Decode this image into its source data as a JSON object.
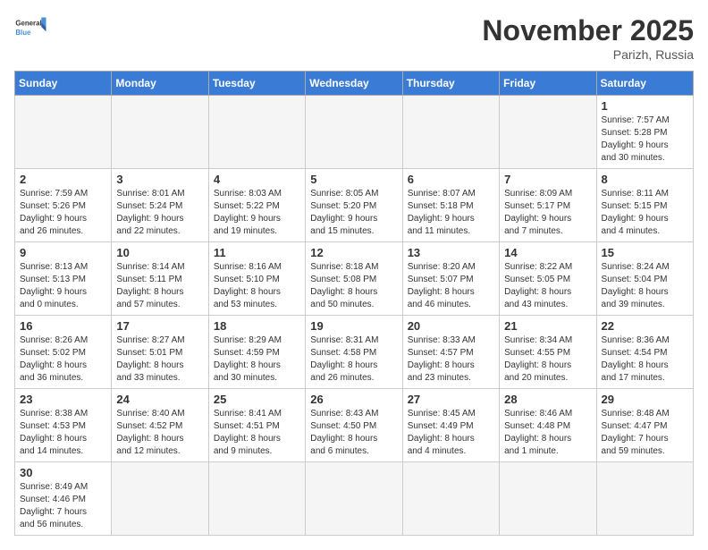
{
  "header": {
    "logo_general": "General",
    "logo_blue": "Blue",
    "month": "November 2025",
    "location": "Parizh, Russia"
  },
  "weekdays": [
    "Sunday",
    "Monday",
    "Tuesday",
    "Wednesday",
    "Thursday",
    "Friday",
    "Saturday"
  ],
  "weeks": [
    [
      {
        "day": "",
        "info": ""
      },
      {
        "day": "",
        "info": ""
      },
      {
        "day": "",
        "info": ""
      },
      {
        "day": "",
        "info": ""
      },
      {
        "day": "",
        "info": ""
      },
      {
        "day": "",
        "info": ""
      },
      {
        "day": "1",
        "info": "Sunrise: 7:57 AM\nSunset: 5:28 PM\nDaylight: 9 hours\nand 30 minutes."
      }
    ],
    [
      {
        "day": "2",
        "info": "Sunrise: 7:59 AM\nSunset: 5:26 PM\nDaylight: 9 hours\nand 26 minutes."
      },
      {
        "day": "3",
        "info": "Sunrise: 8:01 AM\nSunset: 5:24 PM\nDaylight: 9 hours\nand 22 minutes."
      },
      {
        "day": "4",
        "info": "Sunrise: 8:03 AM\nSunset: 5:22 PM\nDaylight: 9 hours\nand 19 minutes."
      },
      {
        "day": "5",
        "info": "Sunrise: 8:05 AM\nSunset: 5:20 PM\nDaylight: 9 hours\nand 15 minutes."
      },
      {
        "day": "6",
        "info": "Sunrise: 8:07 AM\nSunset: 5:18 PM\nDaylight: 9 hours\nand 11 minutes."
      },
      {
        "day": "7",
        "info": "Sunrise: 8:09 AM\nSunset: 5:17 PM\nDaylight: 9 hours\nand 7 minutes."
      },
      {
        "day": "8",
        "info": "Sunrise: 8:11 AM\nSunset: 5:15 PM\nDaylight: 9 hours\nand 4 minutes."
      }
    ],
    [
      {
        "day": "9",
        "info": "Sunrise: 8:13 AM\nSunset: 5:13 PM\nDaylight: 9 hours\nand 0 minutes."
      },
      {
        "day": "10",
        "info": "Sunrise: 8:14 AM\nSunset: 5:11 PM\nDaylight: 8 hours\nand 57 minutes."
      },
      {
        "day": "11",
        "info": "Sunrise: 8:16 AM\nSunset: 5:10 PM\nDaylight: 8 hours\nand 53 minutes."
      },
      {
        "day": "12",
        "info": "Sunrise: 8:18 AM\nSunset: 5:08 PM\nDaylight: 8 hours\nand 50 minutes."
      },
      {
        "day": "13",
        "info": "Sunrise: 8:20 AM\nSunset: 5:07 PM\nDaylight: 8 hours\nand 46 minutes."
      },
      {
        "day": "14",
        "info": "Sunrise: 8:22 AM\nSunset: 5:05 PM\nDaylight: 8 hours\nand 43 minutes."
      },
      {
        "day": "15",
        "info": "Sunrise: 8:24 AM\nSunset: 5:04 PM\nDaylight: 8 hours\nand 39 minutes."
      }
    ],
    [
      {
        "day": "16",
        "info": "Sunrise: 8:26 AM\nSunset: 5:02 PM\nDaylight: 8 hours\nand 36 minutes."
      },
      {
        "day": "17",
        "info": "Sunrise: 8:27 AM\nSunset: 5:01 PM\nDaylight: 8 hours\nand 33 minutes."
      },
      {
        "day": "18",
        "info": "Sunrise: 8:29 AM\nSunset: 4:59 PM\nDaylight: 8 hours\nand 30 minutes."
      },
      {
        "day": "19",
        "info": "Sunrise: 8:31 AM\nSunset: 4:58 PM\nDaylight: 8 hours\nand 26 minutes."
      },
      {
        "day": "20",
        "info": "Sunrise: 8:33 AM\nSunset: 4:57 PM\nDaylight: 8 hours\nand 23 minutes."
      },
      {
        "day": "21",
        "info": "Sunrise: 8:34 AM\nSunset: 4:55 PM\nDaylight: 8 hours\nand 20 minutes."
      },
      {
        "day": "22",
        "info": "Sunrise: 8:36 AM\nSunset: 4:54 PM\nDaylight: 8 hours\nand 17 minutes."
      }
    ],
    [
      {
        "day": "23",
        "info": "Sunrise: 8:38 AM\nSunset: 4:53 PM\nDaylight: 8 hours\nand 14 minutes."
      },
      {
        "day": "24",
        "info": "Sunrise: 8:40 AM\nSunset: 4:52 PM\nDaylight: 8 hours\nand 12 minutes."
      },
      {
        "day": "25",
        "info": "Sunrise: 8:41 AM\nSunset: 4:51 PM\nDaylight: 8 hours\nand 9 minutes."
      },
      {
        "day": "26",
        "info": "Sunrise: 8:43 AM\nSunset: 4:50 PM\nDaylight: 8 hours\nand 6 minutes."
      },
      {
        "day": "27",
        "info": "Sunrise: 8:45 AM\nSunset: 4:49 PM\nDaylight: 8 hours\nand 4 minutes."
      },
      {
        "day": "28",
        "info": "Sunrise: 8:46 AM\nSunset: 4:48 PM\nDaylight: 8 hours\nand 1 minute."
      },
      {
        "day": "29",
        "info": "Sunrise: 8:48 AM\nSunset: 4:47 PM\nDaylight: 7 hours\nand 59 minutes."
      }
    ],
    [
      {
        "day": "30",
        "info": "Sunrise: 8:49 AM\nSunset: 4:46 PM\nDaylight: 7 hours\nand 56 minutes."
      },
      {
        "day": "",
        "info": ""
      },
      {
        "day": "",
        "info": ""
      },
      {
        "day": "",
        "info": ""
      },
      {
        "day": "",
        "info": ""
      },
      {
        "day": "",
        "info": ""
      },
      {
        "day": "",
        "info": ""
      }
    ]
  ]
}
